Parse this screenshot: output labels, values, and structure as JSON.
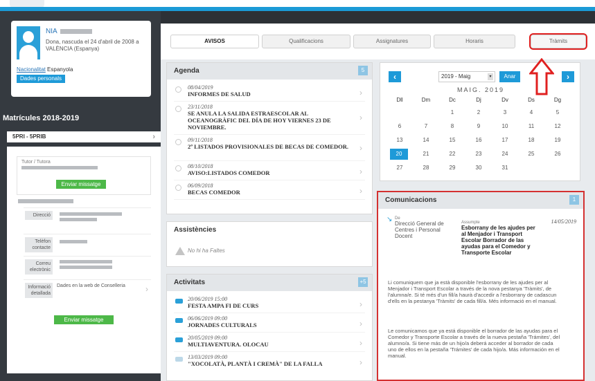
{
  "student": {
    "nia_label": "NIA",
    "birth_text": "Dona, nascuda el 24 d'abril de 2008 a VALÈNCIA (Espanya)",
    "nationality_label": "Nacionalitat",
    "nationality_value": "Espanyola",
    "personal_data_button": "Dades personals"
  },
  "enrolments": {
    "title": "Matrícules 2018-2019",
    "selected": "5PRI - 5PRIB",
    "tutor_label": "Tutor / Tutora",
    "send_message_button": "Enviar missatge",
    "rows": [
      {
        "label": "Direcció"
      },
      {
        "label": "Telèfon contacte"
      },
      {
        "label": "Correu electrònic"
      },
      {
        "label": "Informació detallada",
        "value": "Dades en la web de Conselleria"
      }
    ],
    "send_message_button2": "Enviar missatge"
  },
  "tabs": [
    "AVISOS",
    "Qualificacions",
    "Assignatures",
    "Horaris",
    "Tràmits"
  ],
  "agenda": {
    "title": "Agenda",
    "badge": "5",
    "items": [
      {
        "date": "08/04/2019",
        "title": "INFORMES DE SALUD"
      },
      {
        "date": "23/11/2018",
        "title": "SE ANULA LA SALIDA ESTRAESCOLAR AL OCEANOGRÀFIC DEL DÍA DE HOY VIERNES 23 DE NOVIEMBRE."
      },
      {
        "date": "09/11/2018",
        "title": "2º LISTADOS PROVISIONALES DE BECAS DE COMEDOR."
      },
      {
        "date": "08/10/2018",
        "title": "AVISO:LISTADOS COMEDOR"
      },
      {
        "date": "06/09/2018",
        "title": "BECAS COMEDOR"
      }
    ]
  },
  "assistencies": {
    "title": "Assistències",
    "empty": "No hi ha Faltes"
  },
  "activitats": {
    "title": "Activitats",
    "badge": "+5",
    "items": [
      {
        "date": "20/06/2019 15:00",
        "title": "FESTA AMPA FI DE CURS"
      },
      {
        "date": "06/06/2019 09:00",
        "title": "JORNADES CULTURALS"
      },
      {
        "date": "20/05/2019 09:00",
        "title": "MULTIAVENTURA. OLOCAU"
      },
      {
        "date": "13/03/2019 09:00",
        "title": "\"XOCOLATÀ, PLANTÀ I CREMÀ\" DE LA FALLA"
      }
    ]
  },
  "calendar": {
    "select_value": "2019 - Maig",
    "go_button": "Anar",
    "month_label": "MAIG. 2019",
    "weekdays": [
      "Dll",
      "Dm",
      "Dc",
      "Dj",
      "Dv",
      "Ds",
      "Dg"
    ],
    "weeks": [
      [
        "",
        "",
        "1",
        "2",
        "3",
        "4",
        "5"
      ],
      [
        "6",
        "7",
        "8",
        "9",
        "10",
        "11",
        "12"
      ],
      [
        "13",
        "14",
        "15",
        "16",
        "17",
        "18",
        "19"
      ],
      [
        "20",
        "21",
        "22",
        "23",
        "24",
        "25",
        "26"
      ],
      [
        "27",
        "28",
        "29",
        "30",
        "31",
        "",
        ""
      ]
    ],
    "today": "20"
  },
  "comunicacions": {
    "title": "Comunicacions",
    "badge": "1",
    "from_label": "De",
    "from_value": "Direcció General de Centres i Personal Docent",
    "subject_label": "Assumpte",
    "subject_value": "Esborrany de les ajudes per al Menjador i Transport Escolar Borrador de las ayudas para el Comedor y Transporte Escolar",
    "date": "14/05/2019",
    "para1": "Li comuniquem que ja està disponible l'esborrany de les ajudes per al Menjador i Transport Escolar a través de la nova pestanya 'Tràmits', de l'alumna/e. Si té més d'un fill/a haurà d'accedir a l'esborrany de cadascun d'ells en la pestanya 'Tràmits' de cada fill/a. Més informació en el manual.",
    "para2": "Le comunicamos que ya está disponible el borrador de las ayudas para el Comedor y Transporte Escolar a través de la nueva pestaña 'Trámites', del alumno/a. Si tiene más de un hijo/a deberá acceder al borrador de cada uno de ellos en la pestaña 'Trámites' de cada hijo/a. Más información en el manual."
  },
  "colors": {
    "accent": "#1e9ad8",
    "highlight": "#e02020",
    "green": "#4db848"
  }
}
